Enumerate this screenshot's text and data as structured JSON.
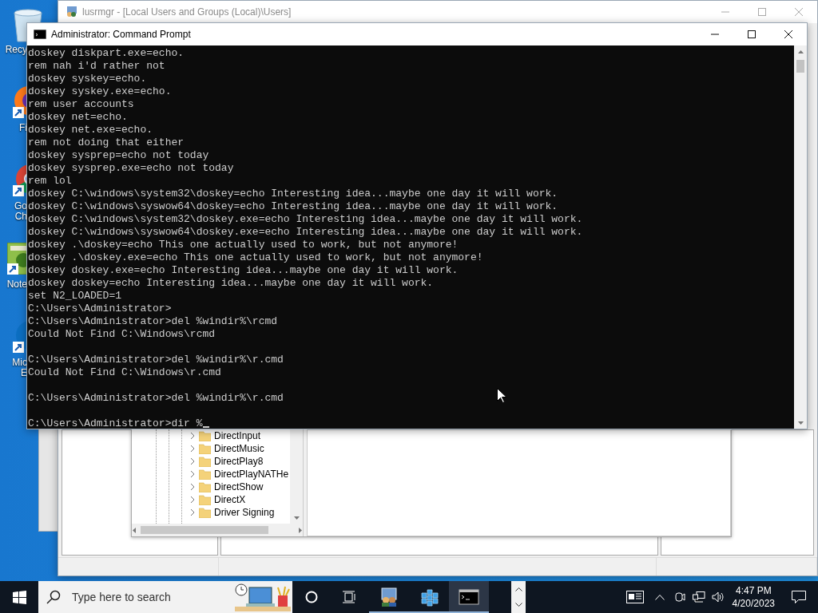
{
  "desktop_icons": [
    {
      "kind": "recycle-bin",
      "label_lines": [
        "Recy"
      ]
    },
    {
      "kind": "firefox",
      "label_lines": [
        "Fi"
      ]
    },
    {
      "kind": "chrome",
      "label_lines": [
        "Go",
        "Ch"
      ]
    },
    {
      "kind": "notepad",
      "label_lines": [
        "Note"
      ]
    },
    {
      "kind": "edge",
      "label_lines": [
        "Mic",
        "E"
      ]
    }
  ],
  "background_window": {
    "title": "lusrmgr - [Local Users and Groups (Local)\\Users]"
  },
  "registry_tree": {
    "items": [
      "DirectInput",
      "DirectMusic",
      "DirectPlay8",
      "DirectPlayNATHe",
      "DirectShow",
      "DirectX",
      "Driver Signing"
    ]
  },
  "console": {
    "title": "Administrator: Command Prompt",
    "blocks": [
      [
        "doskey diskpart.exe=echo.",
        "rem nah i'd rather not",
        "doskey syskey=echo.",
        "doskey syskey.exe=echo.",
        "rem user accounts",
        "doskey net=echo.",
        "doskey net.exe=echo.",
        "rem not doing that either",
        "doskey sysprep=echo not today",
        "doskey sysprep.exe=echo not today",
        "rem lol",
        "doskey C:\\windows\\system32\\doskey=echo Interesting idea...maybe one day it will work.",
        "doskey C:\\windows\\syswow64\\doskey=echo Interesting idea...maybe one day it will work.",
        "doskey C:\\windows\\system32\\doskey.exe=echo Interesting idea...maybe one day it will work.",
        "doskey C:\\windows\\syswow64\\doskey.exe=echo Interesting idea...maybe one day it will work.",
        "doskey .\\doskey=echo This one actually used to work, but not anymore!",
        "doskey .\\doskey.exe=echo This one actually used to work, but not anymore!",
        "doskey doskey.exe=echo Interesting idea...maybe one day it will work.",
        "doskey doskey=echo Interesting idea...maybe one day it will work.",
        "set N2_LOADED=1",
        "C:\\Users\\Administrator>",
        "C:\\Users\\Administrator>del %windir%\\rcmd",
        "Could Not Find C:\\Windows\\rcmd"
      ],
      [
        "C:\\Users\\Administrator>del %windir%\\r.cmd",
        "Could Not Find C:\\Windows\\r.cmd"
      ],
      [
        "C:\\Users\\Administrator>del %windir%\\r.cmd"
      ],
      [
        "C:\\Users\\Administrator>dir %"
      ]
    ]
  },
  "taskbar": {
    "search": {
      "placeholder": "Type here to search"
    },
    "apps": [
      {
        "kind": "users",
        "selected": false
      },
      {
        "kind": "registry",
        "selected": false
      },
      {
        "kind": "console",
        "selected": true
      }
    ],
    "clock": {
      "time": "4:47 PM",
      "date": "4/20/2023"
    }
  }
}
